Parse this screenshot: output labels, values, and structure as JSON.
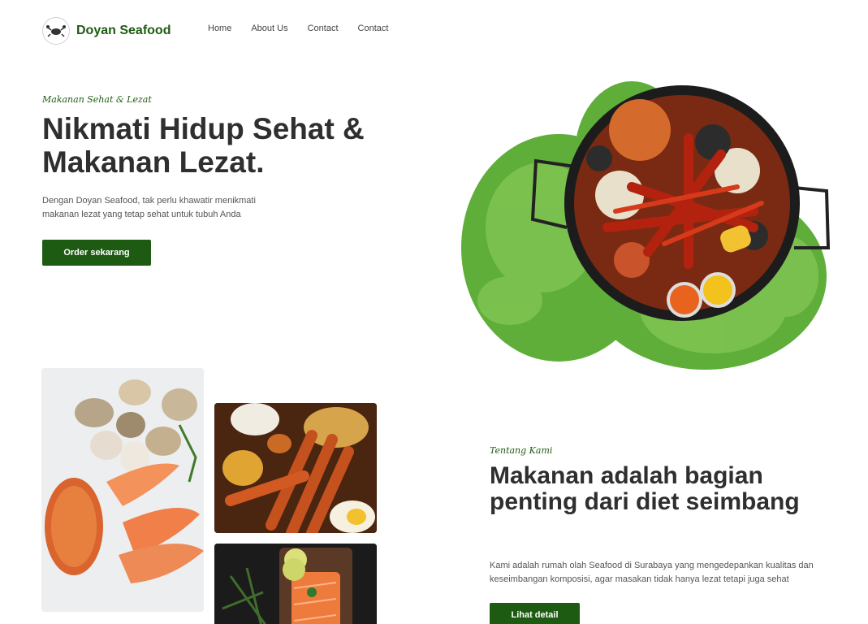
{
  "nav": {
    "brand": "Doyan Seafood",
    "logo_icon": "crab-logo-icon",
    "menu": [
      "Home",
      "About Us",
      "Contact",
      "Contact"
    ]
  },
  "hero": {
    "tagline": "Makanan Sehat & Lezat",
    "title": "Nikmati Hidup Sehat & Makanan Lezat.",
    "description": "Dengan Doyan Seafood, tak perlu khawatir menikmati makanan lezat yang tetap sehat untuk tubuh Anda",
    "button": "Order sekarang"
  },
  "about": {
    "tagline": "Tentang Kami",
    "title": "Makanan adalah bagian penting dari diet seimbang",
    "description": "Kami adalah rumah olah Seafood di Surabaya yang mengedepankan kualitas dan keseimbangan komposisi, agar masakan tidak hanya lezat tetapi juga sehat",
    "button": "Lihat detail"
  },
  "colors": {
    "brand": "#1e5b12",
    "text": "#2f2f2f",
    "muted": "#555555"
  }
}
